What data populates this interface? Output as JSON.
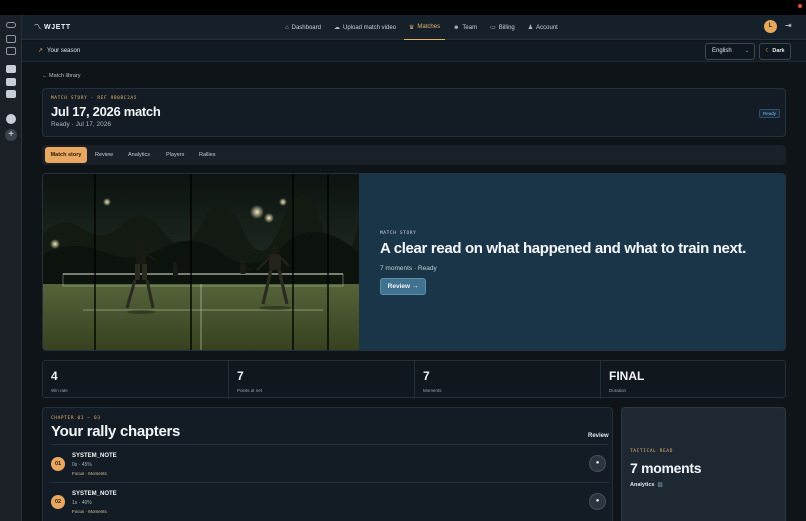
{
  "nav": {
    "brand": "WJETT",
    "links": [
      {
        "label": "Dashboard",
        "icon": "home-icon"
      },
      {
        "label": "Upload match video",
        "icon": "cloud-upload-icon"
      },
      {
        "label": "Matches",
        "icon": "matches-icon",
        "active": true
      },
      {
        "label": "Team",
        "icon": "team-icon"
      },
      {
        "label": "Billing",
        "icon": "card-icon"
      },
      {
        "label": "Account",
        "icon": "user-icon"
      }
    ],
    "avatar_initial": "L",
    "accent_color": "#e5b26a"
  },
  "subbar": {
    "season_label": "Your season",
    "language": "English",
    "theme_label": "Dark"
  },
  "back_link": "Match library",
  "header": {
    "eyebrow": "MATCH STORY · REF 9B0BC2A5",
    "title": "Jul 17, 2026 match",
    "subtitle": "Ready · Jul 17, 2026",
    "status": "Ready"
  },
  "tabs": [
    "Match story",
    "Review",
    "Analytics",
    "Players",
    "Rallies"
  ],
  "hero": {
    "eyebrow": "MATCH STORY",
    "headline": "A clear read on what happened and what to train next.",
    "meta": "7 moments · Ready",
    "review_label": "Review"
  },
  "stats": [
    {
      "value": "4",
      "label": "Win rate"
    },
    {
      "value": "7",
      "label": "Points at net"
    },
    {
      "value": "7",
      "label": "Moments"
    },
    {
      "value": "FINAL",
      "label": "Duration"
    }
  ],
  "chapters": {
    "eyebrow": "CHAPTER 01 — 03",
    "title": "Your rally chapters",
    "review_label": "Review",
    "items": [
      {
        "num": "01",
        "name": "SYSTEM_NOTE",
        "stat": "0s · 45%",
        "tags": "Focus · Moments"
      },
      {
        "num": "02",
        "name": "SYSTEM_NOTE",
        "stat": "1s · 40%",
        "tags": "Focus · Moments"
      }
    ]
  },
  "tactical": {
    "eyebrow": "TACTICAL READ",
    "title": "7 moments",
    "link": "Analytics"
  }
}
